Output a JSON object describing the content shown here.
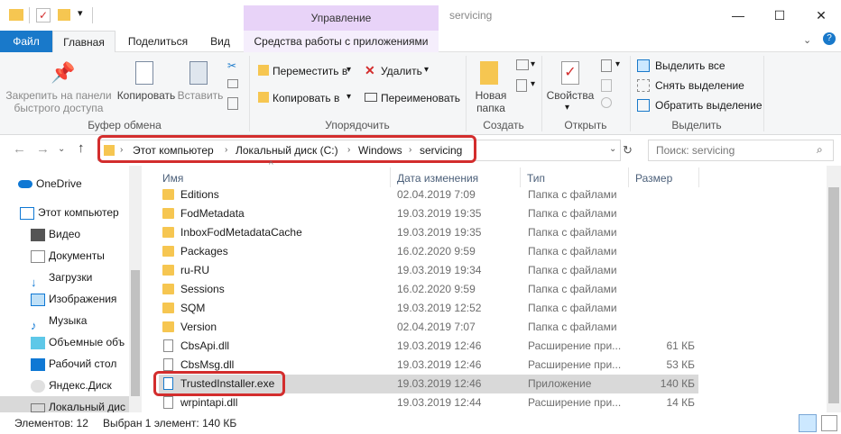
{
  "window": {
    "context_tab": "Управление",
    "title": "servicing",
    "minimize": "—",
    "maximize": "☐",
    "close": "✕"
  },
  "tabs": {
    "file": "Файл",
    "home": "Главная",
    "share": "Поделиться",
    "view": "Вид",
    "app_tools": "Средства работы с приложениями"
  },
  "ribbon": {
    "clipboard": {
      "group": "Буфер обмена",
      "pin": "Закрепить на панели быстрого доступа",
      "pin_line1": "Закрепить на панели",
      "pin_line2": "быстрого доступа",
      "copy": "Копировать",
      "paste": "Вставить"
    },
    "organize": {
      "group": "Упорядочить",
      "move": "Переместить в",
      "copy_to": "Копировать в",
      "delete": "Удалить",
      "rename": "Переименовать"
    },
    "new": {
      "group": "Создать",
      "new_folder_line1": "Новая",
      "new_folder_line2": "папка"
    },
    "open": {
      "group": "Открыть",
      "properties": "Свойства"
    },
    "select": {
      "group": "Выделить",
      "select_all": "Выделить все",
      "select_none": "Снять выделение",
      "invert": "Обратить выделение"
    }
  },
  "address": {
    "crumbs": [
      "Этот компьютер",
      "Локальный диск (C:)",
      "Windows",
      "servicing"
    ],
    "search_placeholder": "Поиск: servicing"
  },
  "nav": {
    "items": [
      {
        "label": "OneDrive",
        "icon": "cloud-icon"
      },
      {
        "label": "Этот компьютер",
        "icon": "computer-icon"
      },
      {
        "label": "Видео",
        "icon": "video-icon"
      },
      {
        "label": "Документы",
        "icon": "documents-icon"
      },
      {
        "label": "Загрузки",
        "icon": "download-icon"
      },
      {
        "label": "Изображения",
        "icon": "pictures-icon"
      },
      {
        "label": "Музыка",
        "icon": "music-icon"
      },
      {
        "label": "Объемные объ",
        "icon": "3d-objects-icon"
      },
      {
        "label": "Рабочий стол",
        "icon": "desktop-icon"
      },
      {
        "label": "Яндекс.Диск",
        "icon": "yandex-disk-icon"
      },
      {
        "label": "Локальный дис",
        "icon": "drive-icon"
      }
    ]
  },
  "list": {
    "headers": {
      "name": "Имя",
      "date": "Дата изменения",
      "type": "Тип",
      "size": "Размер"
    },
    "rows": [
      {
        "name": "Editions",
        "date": "02.04.2019 7:09",
        "type": "Папка с файлами",
        "size": "",
        "kind": "folder"
      },
      {
        "name": "FodMetadata",
        "date": "19.03.2019 19:35",
        "type": "Папка с файлами",
        "size": "",
        "kind": "folder"
      },
      {
        "name": "InboxFodMetadataCache",
        "date": "19.03.2019 19:35",
        "type": "Папка с файлами",
        "size": "",
        "kind": "folder"
      },
      {
        "name": "Packages",
        "date": "16.02.2020 9:59",
        "type": "Папка с файлами",
        "size": "",
        "kind": "folder"
      },
      {
        "name": "ru-RU",
        "date": "19.03.2019 19:34",
        "type": "Папка с файлами",
        "size": "",
        "kind": "folder"
      },
      {
        "name": "Sessions",
        "date": "16.02.2020 9:59",
        "type": "Папка с файлами",
        "size": "",
        "kind": "folder"
      },
      {
        "name": "SQM",
        "date": "19.03.2019 12:52",
        "type": "Папка с файлами",
        "size": "",
        "kind": "folder"
      },
      {
        "name": "Version",
        "date": "02.04.2019 7:07",
        "type": "Папка с файлами",
        "size": "",
        "kind": "folder"
      },
      {
        "name": "CbsApi.dll",
        "date": "19.03.2019 12:46",
        "type": "Расширение при...",
        "size": "61 КБ",
        "kind": "dll"
      },
      {
        "name": "CbsMsg.dll",
        "date": "19.03.2019 12:46",
        "type": "Расширение при...",
        "size": "53 КБ",
        "kind": "dll"
      },
      {
        "name": "TrustedInstaller.exe",
        "date": "19.03.2019 12:46",
        "type": "Приложение",
        "size": "140 КБ",
        "kind": "exe"
      },
      {
        "name": "wrpintapi.dll",
        "date": "19.03.2019 12:44",
        "type": "Расширение при...",
        "size": "14 КБ",
        "kind": "dll"
      }
    ]
  },
  "status": {
    "count": "Элементов: 12",
    "selected": "Выбран 1 элемент: 140 КБ"
  },
  "colors": {
    "accent": "#1979ca",
    "context_tab": "#e8d3f8",
    "selection": "#cce8ff",
    "highlight": "#d32d2d",
    "folder": "#f6c651"
  }
}
